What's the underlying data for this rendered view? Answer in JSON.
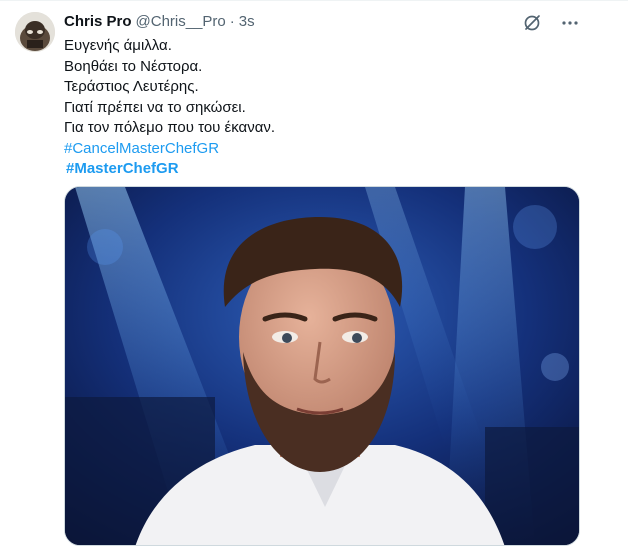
{
  "tweet": {
    "display_name": "Chris Pro",
    "handle": "@Chris__Pro",
    "separator": "·",
    "time": "3s",
    "lines": [
      "Ευγενής άμιλλα.",
      "Βοηθάει το Νέστορα.",
      "Τεράστιος Λευτέρης.",
      "Γιατί πρέπει να το σηκώσει.",
      "Για τον πόλεμο που του έκαναν."
    ],
    "hashtags": [
      "#CancelMasterChefGR",
      "#MasterChefGR"
    ]
  },
  "actions": {
    "grok_icon": "grok-slash-icon",
    "more_icon": "more-dots-icon"
  },
  "colors": {
    "link": "#1d9bf0",
    "text": "#0f1419",
    "secondary": "#536471"
  }
}
